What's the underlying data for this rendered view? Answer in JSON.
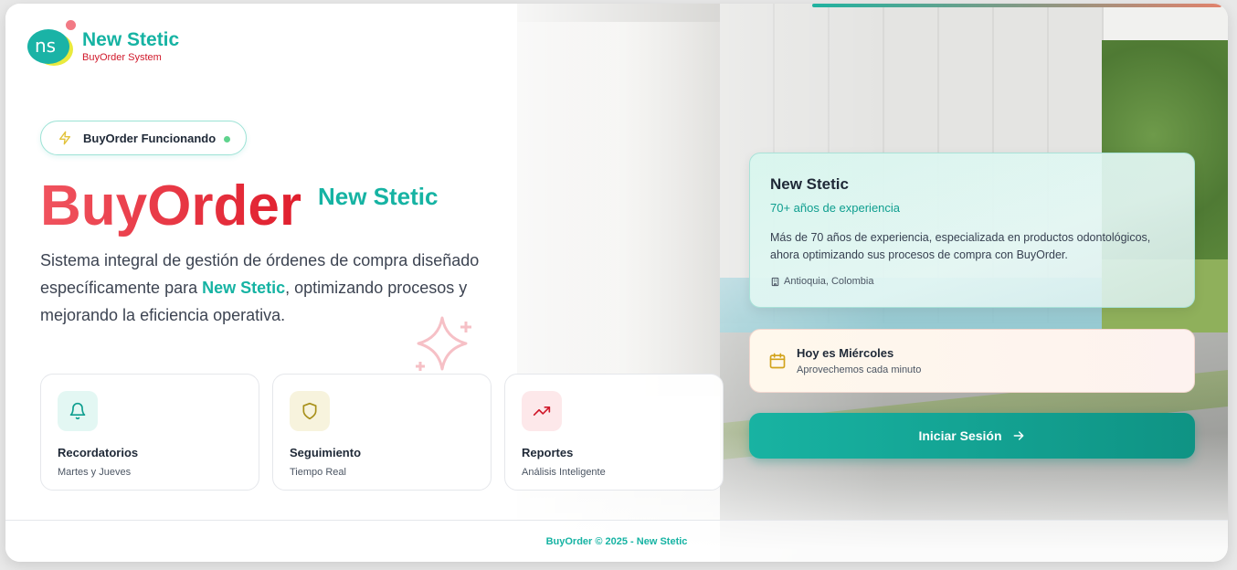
{
  "brand": {
    "name": "New Stetic",
    "subtitle": "BuyOrder System",
    "logo_text": "ns"
  },
  "status_pill": {
    "label": "BuyOrder Funcionando",
    "icon": "lightning-icon",
    "indicator_color": "#5fd38d"
  },
  "hero": {
    "title": "BuyOrder",
    "title_tag": "New Stetic",
    "description_before": "Sistema integral de gestión de órdenes de compra diseñado específicamente para ",
    "description_highlight": "New Stetic",
    "description_after": ", optimizando procesos y mejorando la eficiencia operativa."
  },
  "features": [
    {
      "title": "Recordatorios",
      "subtitle": "Martes y Jueves",
      "icon": "bell-icon",
      "color": "#0e9e8f"
    },
    {
      "title": "Seguimiento",
      "subtitle": "Tiempo Real",
      "icon": "shield-icon",
      "color": "#a8901a"
    },
    {
      "title": "Reportes",
      "subtitle": "Análisis Inteligente",
      "icon": "trending-up-icon",
      "color": "#d0182a"
    }
  ],
  "company_card": {
    "title": "New Stetic",
    "years": "70+ años de experiencia",
    "body": "Más de 70 años de experiencia, especializada en productos odontológicos, ahora optimizando sus procesos de compra con BuyOrder.",
    "location": "Antioquia, Colombia"
  },
  "day_card": {
    "title": "Hoy es Miércoles",
    "subtitle": "Aprovechemos cada minuto"
  },
  "login": {
    "label": "Iniciar Sesión"
  },
  "footer": {
    "text": "BuyOrder © 2025 - New Stetic"
  },
  "colors": {
    "accent": "#16b3a3",
    "brand_red": "#d0182a"
  }
}
